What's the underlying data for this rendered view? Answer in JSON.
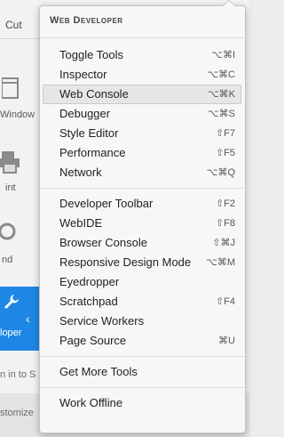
{
  "background_panel": {
    "cut": "Cut",
    "window": "Window",
    "print": "int",
    "find": "nd",
    "developer": "loper",
    "sign_in": "n in to S",
    "customize": "stomize"
  },
  "menu": {
    "header": "Web Developer",
    "groups": [
      {
        "items": [
          {
            "label": "Toggle Tools",
            "shortcut": "⌥⌘I"
          },
          {
            "label": "Inspector",
            "shortcut": "⌥⌘C"
          },
          {
            "label": "Web Console",
            "shortcut": "⌥⌘K",
            "active": true
          },
          {
            "label": "Debugger",
            "shortcut": "⌥⌘S"
          },
          {
            "label": "Style Editor",
            "shortcut": "⇧F7"
          },
          {
            "label": "Performance",
            "shortcut": "⇧F5"
          },
          {
            "label": "Network",
            "shortcut": "⌥⌘Q"
          }
        ]
      },
      {
        "items": [
          {
            "label": "Developer Toolbar",
            "shortcut": "⇧F2"
          },
          {
            "label": "WebIDE",
            "shortcut": "⇧F8"
          },
          {
            "label": "Browser Console",
            "shortcut": "⇧⌘J"
          },
          {
            "label": "Responsive Design Mode",
            "shortcut": "⌥⌘M"
          },
          {
            "label": "Eyedropper",
            "shortcut": ""
          },
          {
            "label": "Scratchpad",
            "shortcut": "⇧F4"
          },
          {
            "label": "Service Workers",
            "shortcut": ""
          },
          {
            "label": "Page Source",
            "shortcut": "⌘U"
          }
        ]
      },
      {
        "items": [
          {
            "label": "Get More Tools",
            "shortcut": ""
          }
        ]
      },
      {
        "items": [
          {
            "label": "Work Offline",
            "shortcut": ""
          }
        ]
      }
    ]
  },
  "colors": {
    "accent": "#1e87e5",
    "menu_bg": "#f7f7f7",
    "active_bg": "#e6e6e6"
  }
}
